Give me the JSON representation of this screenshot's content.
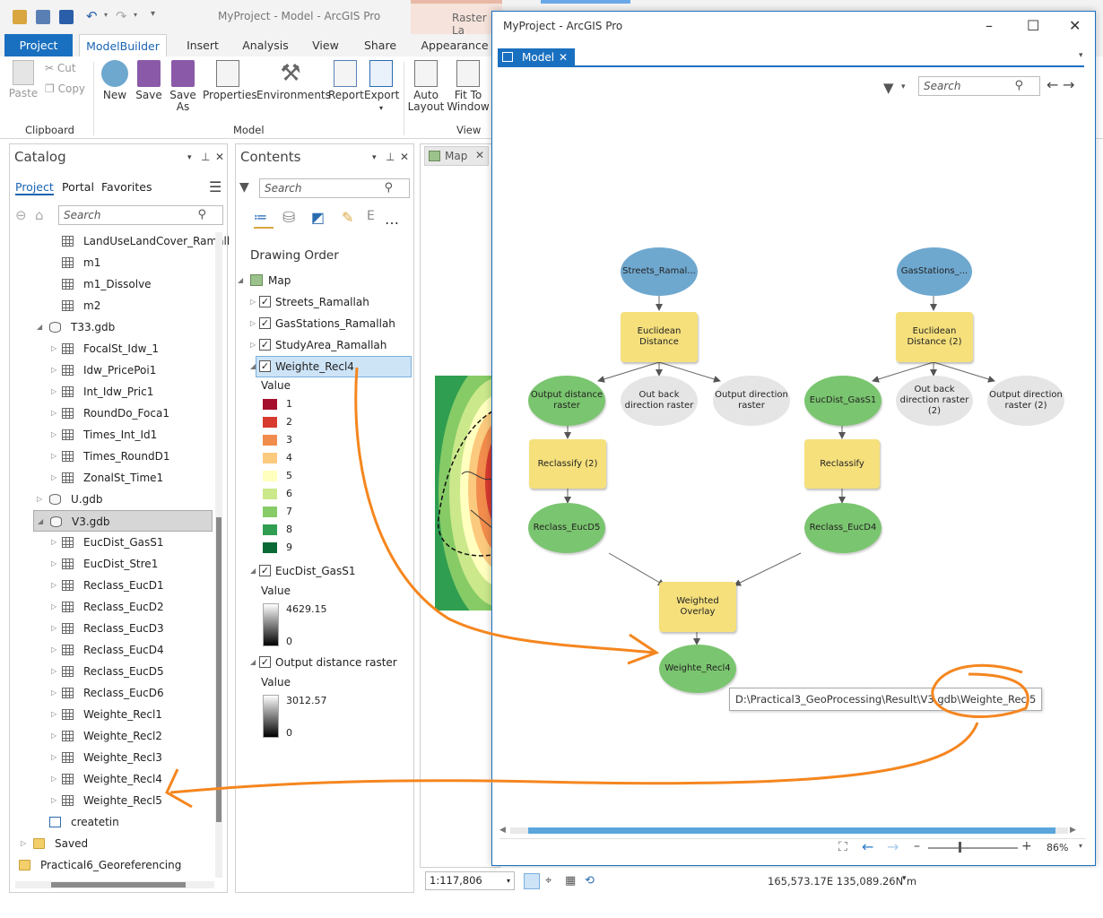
{
  "app": {
    "title": "MyProject - Model - ArcGIS Pro",
    "context_tab_raster": "Raster La",
    "tabs": [
      "Project",
      "ModelBuilder",
      "Insert",
      "Analysis",
      "View",
      "Share",
      "Appearance"
    ]
  },
  "ribbon": {
    "clipboard": {
      "paste": "Paste",
      "cut": "Cut",
      "copy": "Copy",
      "group": "Clipboard"
    },
    "model": {
      "new": "New",
      "save": "Save",
      "save_as_1": "Save",
      "save_as_2": "As",
      "properties": "Properties",
      "environments": "Environments",
      "report": "Report",
      "export": "Export",
      "group": "Model"
    },
    "view": {
      "auto_layout_1": "Auto",
      "auto_layout_2": "Layout",
      "fit_1": "Fit To",
      "fit_2": "Window",
      "group": "View"
    }
  },
  "catalog": {
    "title": "Catalog",
    "tabs": [
      "Project",
      "Portal",
      "Favorites"
    ],
    "search_placeholder": "Search",
    "rows": [
      {
        "label": "LandUseLandCover_Ramall"
      },
      {
        "label": "m1"
      },
      {
        "label": "m1_Dissolve"
      },
      {
        "label": "m2"
      },
      {
        "label": "T33.gdb"
      },
      {
        "label": "FocalSt_Idw_1"
      },
      {
        "label": "Idw_PricePoi1"
      },
      {
        "label": "Int_Idw_Pric1"
      },
      {
        "label": "RoundDo_Foca1"
      },
      {
        "label": "Times_Int_Id1"
      },
      {
        "label": "Times_RoundD1"
      },
      {
        "label": "ZonalSt_Time1"
      },
      {
        "label": "U.gdb"
      },
      {
        "label": "V3.gdb"
      },
      {
        "label": "EucDist_GasS1"
      },
      {
        "label": "EucDist_Stre1"
      },
      {
        "label": "Reclass_EucD1"
      },
      {
        "label": "Reclass_EucD2"
      },
      {
        "label": "Reclass_EucD3"
      },
      {
        "label": "Reclass_EucD4"
      },
      {
        "label": "Reclass_EucD5"
      },
      {
        "label": "Reclass_EucD6"
      },
      {
        "label": "Weighte_Recl1"
      },
      {
        "label": "Weighte_Recl2"
      },
      {
        "label": "Weighte_Recl3"
      },
      {
        "label": "Weighte_Recl4"
      },
      {
        "label": "Weighte_Recl5"
      },
      {
        "label": "createtin"
      },
      {
        "label": "Saved"
      },
      {
        "label": "Practical6_Georeferencing"
      }
    ]
  },
  "contents": {
    "title": "Contents",
    "search_placeholder": "Search",
    "drawing_order": "Drawing Order",
    "map": "Map",
    "layers": [
      "Streets_Ramallah",
      "GasStations_Ramallah",
      "StudyArea_Ramallah",
      "Weighte_Recl4"
    ],
    "value_label": "Value",
    "classes": [
      "1",
      "2",
      "3",
      "4",
      "5",
      "6",
      "7",
      "8",
      "9"
    ],
    "class_colors": [
      "#a50f2d",
      "#d73a2f",
      "#f28c4c",
      "#fcca7e",
      "#ffffbf",
      "#cbe88b",
      "#86cb66",
      "#2f9e50",
      "#0a6a36"
    ],
    "eucdist_layer": "EucDist_GasS1",
    "eucdist_max": "4629.15",
    "eucdist_min": "0",
    "outdist_layer": "Output distance raster",
    "outdist_max": "3012.57",
    "outdist_min": "0"
  },
  "map_tab": {
    "label": "Map"
  },
  "model_window": {
    "title": "MyProject - ArcGIS Pro",
    "tab": "Model",
    "search_placeholder": "Search",
    "nodes": {
      "streets": "Streets_Ramal...",
      "gas": "GasStations_...",
      "euc1": "Euclidean Distance",
      "euc2": "Euclidean Distance (2)",
      "outdist1": "Output distance raster",
      "outback1": "Out back direction raster",
      "outdir1": "Output direction raster",
      "eucdist_gas": "EucDist_GasS1",
      "outback2": "Out back direction raster (2)",
      "outdir2": "Output direction raster (2)",
      "reclass2": "Reclassify (2)",
      "reclass1": "Reclassify",
      "reclass_eucd5": "Reclass_EucD5",
      "reclass_eucd4": "Reclass_EucD4",
      "weighted": "Weighted Overlay",
      "weighte_recl4": "Weighte_Recl4"
    },
    "tooltip": "D:\\Practical3_GeoProcessing\\Result\\V3.gdb\\Weighte_Recl5",
    "zoom": "86%"
  },
  "statusbar": {
    "scale": "1:117,806",
    "coords": "165,573.17E 135,089.26N m"
  }
}
